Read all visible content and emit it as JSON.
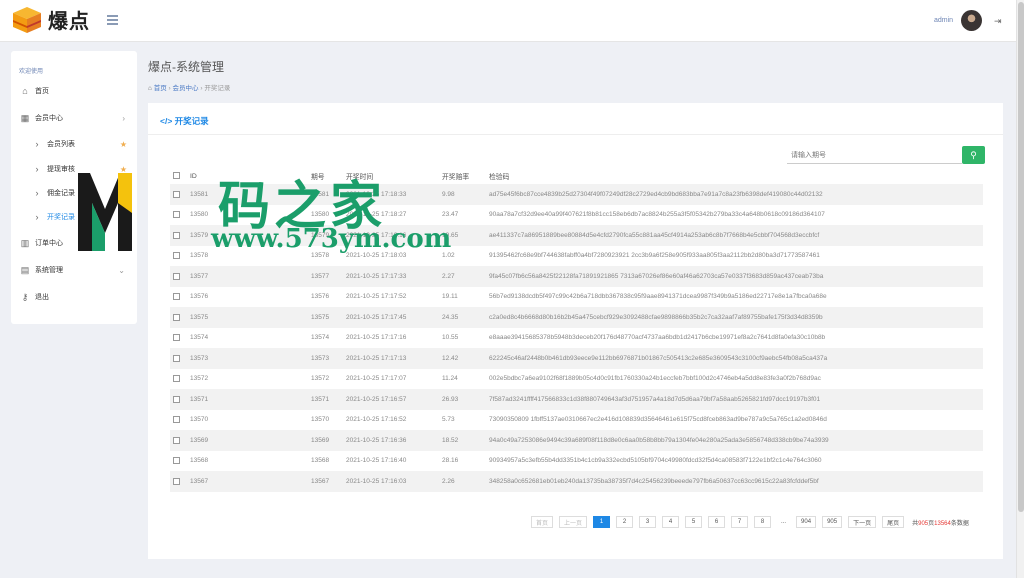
{
  "header": {
    "brand": "爆点",
    "user": "admin"
  },
  "sidebar": {
    "welcome": "欢迎使用",
    "items": [
      {
        "label": "首页",
        "icon": "home-icon"
      },
      {
        "label": "会员中心",
        "icon": "table-icon"
      },
      {
        "label": "会员列表"
      },
      {
        "label": "提现审核"
      },
      {
        "label": "佣金记录"
      },
      {
        "label": "开奖记录"
      },
      {
        "label": "订单中心",
        "icon": "bar-chart-icon"
      },
      {
        "label": "系统管理",
        "icon": "grid-icon"
      },
      {
        "label": "退出",
        "icon": "key-icon"
      }
    ]
  },
  "page": {
    "title": "爆点-系统管理",
    "breadcrumb": [
      "首页",
      "会员中心",
      "开奖记录"
    ],
    "panel_title": "开奖记录"
  },
  "search": {
    "placeholder": "请输入期号"
  },
  "table": {
    "headers": [
      "ID",
      "期号",
      "开奖时间",
      "开奖赔率",
      "检验码"
    ],
    "rows": [
      [
        "13581",
        "13581",
        "2021-10-25 17:18:33",
        "9.98",
        "ad75e45f6bc87cce4839b25d27304f49f07249df28c2729ed4cb9bd683bba7e91a7c8a23fb6398def419080c44d02132"
      ],
      [
        "13580",
        "13580",
        "2021-10-25 17:18:27",
        "23.47",
        "90aa78a7cf32d9ee40a99f407621f8b81cc158eb6db7ac8824b255a3f5f05342b279ba33c4a648b0618c09186d364107"
      ],
      [
        "13579",
        "13579",
        "2021-10-25 17:18:16",
        "19.65",
        "ae411337c7a86951889bee80884d5e4cfd2790fca55c881aa45cf4914a253ab6c8b7f7668b4e5cbbf704568d3eccbfcf"
      ],
      [
        "13578",
        "13578",
        "2021-10-25 17:18:03",
        "1.02",
        "91395462fc68e9bf744638fabff0a4bf7280923921 2cc3b9a6f258e905f933aa805f3aa2112bb2d80ba3d71773587461"
      ],
      [
        "13577",
        "13577",
        "2021-10-25 17:17:33",
        "2.27",
        "9fa45c07fb6c56a8425f22128fa71891921865 7313a67026ef86e60af46a62703ca57e0337f3683d859ac437ceab73ba"
      ],
      [
        "13576",
        "13576",
        "2021-10-25 17:17:52",
        "19.11",
        "56b7ed9138dcdb5f497c99c42b6a718dbb367838c95f9aae8941371dcea9987f349b9a5186ed22717e8e1a7fbca0a68e"
      ],
      [
        "13575",
        "13575",
        "2021-10-25 17:17:45",
        "24.35",
        "c2a0ed8c4b6668d80b16b2b45a475cebcf929e3092488cfae9898866b35b2c7ca32aaf7af89755bafe175f3d34d8359b"
      ],
      [
        "13574",
        "13574",
        "2021-10-25 17:17:16",
        "10.55",
        "e8aaae39415685378b5948b3deceb20f176d48770acf4737aa6bdb1d2417b6cbe19971ef8a2c7641d8fa0efa30c10b8b"
      ],
      [
        "13573",
        "13573",
        "2021-10-25 17:17:13",
        "12.42",
        "622245c46af2448b0b461db93eece9e112bb6976871b01867c505413c2e685e3609543c3100cf9aebc54fb08a5ca437a"
      ],
      [
        "13572",
        "13572",
        "2021-10-25 17:17:07",
        "11.24",
        "002e5bdbc7a6ea9102f68f1889b05c4d0c91fb1760330a24b1eccfeb7bbf100d2c4746eb4a5dd8e83fe3a0f2b768d9ac"
      ],
      [
        "13571",
        "13571",
        "2021-10-25 17:16:57",
        "26.93",
        "7f587ad3241ffff417566833c1d38f880749643af3d751957a4a18d7d5d6aa79bf7a58aab5265821fd97dcc19197b3f01"
      ],
      [
        "13570",
        "13570",
        "2021-10-25 17:16:52",
        "5.73",
        "73090350809 1fbff5137ae0310667ec2e416d108839d35646461e615f75cd8fceb863ad9be787a9c5a765c1a2ed0846d"
      ],
      [
        "13569",
        "13569",
        "2021-10-25 17:16:36",
        "18.52",
        "94a0c49a7253086e9494c39a689f08f118d8e0c6aa0b58b8bb79a1304fe04e280a25ada3e5856748d338cb9be74a3939"
      ],
      [
        "13568",
        "13568",
        "2021-10-25 17:16:40",
        "28.16",
        "90934957a5c3efb55b4dd3351b4c1cb9a332ecbd5105bf9704c49980fdcd32f5d4ca08583f7122e1bf2c1c4e764c3060"
      ],
      [
        "13567",
        "13567",
        "2021-10-25 17:16:03",
        "2.26",
        "348258a0c652681eb01eb240da13735ba38735f7d4c25456239beeede797fb6a50637cc63cc9615c22a83fcfddef5bf"
      ]
    ]
  },
  "pagination": {
    "first": "首页",
    "prev": "上一页",
    "pages": [
      "1",
      "2",
      "3",
      "4",
      "5",
      "6",
      "7",
      "8",
      "...",
      "904",
      "905"
    ],
    "current": "1",
    "next": "下一页",
    "last": "尾页",
    "total_prefix": "共",
    "total_pages": "905",
    "total_mid": "页",
    "total_count": "13564",
    "total_suffix": "条数据"
  },
  "watermark": {
    "text_cn": "码之家",
    "text_url": "www.573ym.com"
  },
  "colors": {
    "accent": "#1e88e5",
    "search_button": "#2fb568",
    "watermark": "#1b9e6a",
    "total_highlight": "#e53935"
  }
}
